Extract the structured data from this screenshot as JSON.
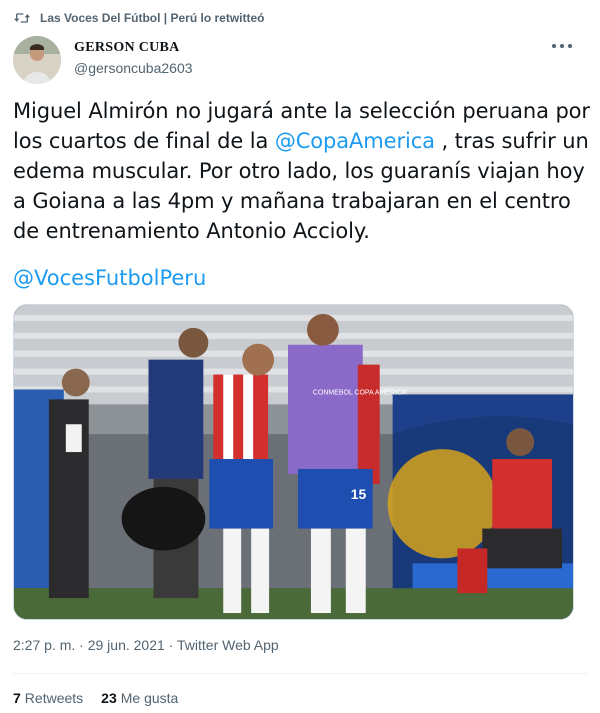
{
  "retweet": {
    "icon": "retweet-icon",
    "text": "Las Voces Del Fútbol | Perú lo retwitteó"
  },
  "author": {
    "name": "GERSON CUBA",
    "handle": "@gersoncuba2603",
    "avatar": "avatar-photo"
  },
  "tweet": {
    "line1": "Miguel Almirón no jugará ante la selección peruana por",
    "line2_pre": "los cuartos de final de la ",
    "line2_mention": "@CopaAmerica",
    "line2_post": " , tras sufrir un",
    "line3": "edema muscular. Por otro lado, los guaranís viajan hoy",
    "line4": "a Goiana a las  4pm y mañana trabajaran en el centro",
    "line5": "de entrenamiento Antonio Accioly.",
    "mention": "@VocesFutbolPeru"
  },
  "media": {
    "description_icon": "photo",
    "bib_text": "CONMEBOL COPA AMERICA",
    "shorts_number": "15"
  },
  "meta": {
    "time": "2:27 p. m.",
    "separator": "·",
    "date": "29 jun. 2021",
    "source": "Twitter Web App"
  },
  "stats": {
    "retweets_count": "7",
    "retweets_label": "Retweets",
    "likes_count": "23",
    "likes_label": "Me gusta"
  }
}
